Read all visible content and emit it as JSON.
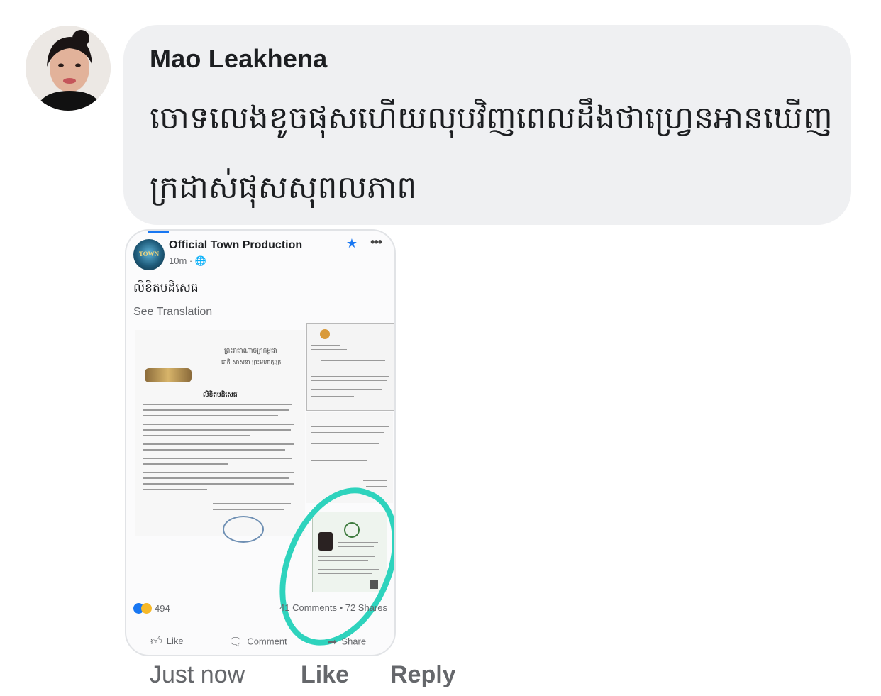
{
  "comment": {
    "author": "Mao Leakhena",
    "text": "ចោទលេងខូចផុសហើយលុបវិញពេលដឹងថាហ្វ្រេនអានឃើញក្រដាស់ផុសសុពលភាព",
    "timestamp": "Just now",
    "like_label": "Like",
    "reply_label": "Reply"
  },
  "attachment": {
    "page_name": "Official Town Production",
    "logo_text": "TOWN",
    "post_time": "10m · 🌐",
    "post_title": "លិខិតបដិសេធ",
    "see_translation": "See Translation",
    "reaction_count": "494",
    "stats": "41 Comments • 72 Shares",
    "actions": {
      "like": "Like",
      "comment": "Comment",
      "share": "Share"
    },
    "letter_header": "ព្រះរាជាណាចក្រកម្ពុជា",
    "letter_subheader": "ជាតិ សាសនា ព្រះមហាក្សត្រ",
    "letter_heading": "លិខិតបដិសេធ"
  },
  "colors": {
    "bubble": "#eff0f2",
    "brand": "#1877f2",
    "highlight_circle": "#2ed3bd",
    "secondary_text": "#65676b"
  },
  "icons": [
    "star-icon",
    "more-icon",
    "globe-icon",
    "thumbs-up-icon",
    "comment-icon",
    "share-icon"
  ]
}
